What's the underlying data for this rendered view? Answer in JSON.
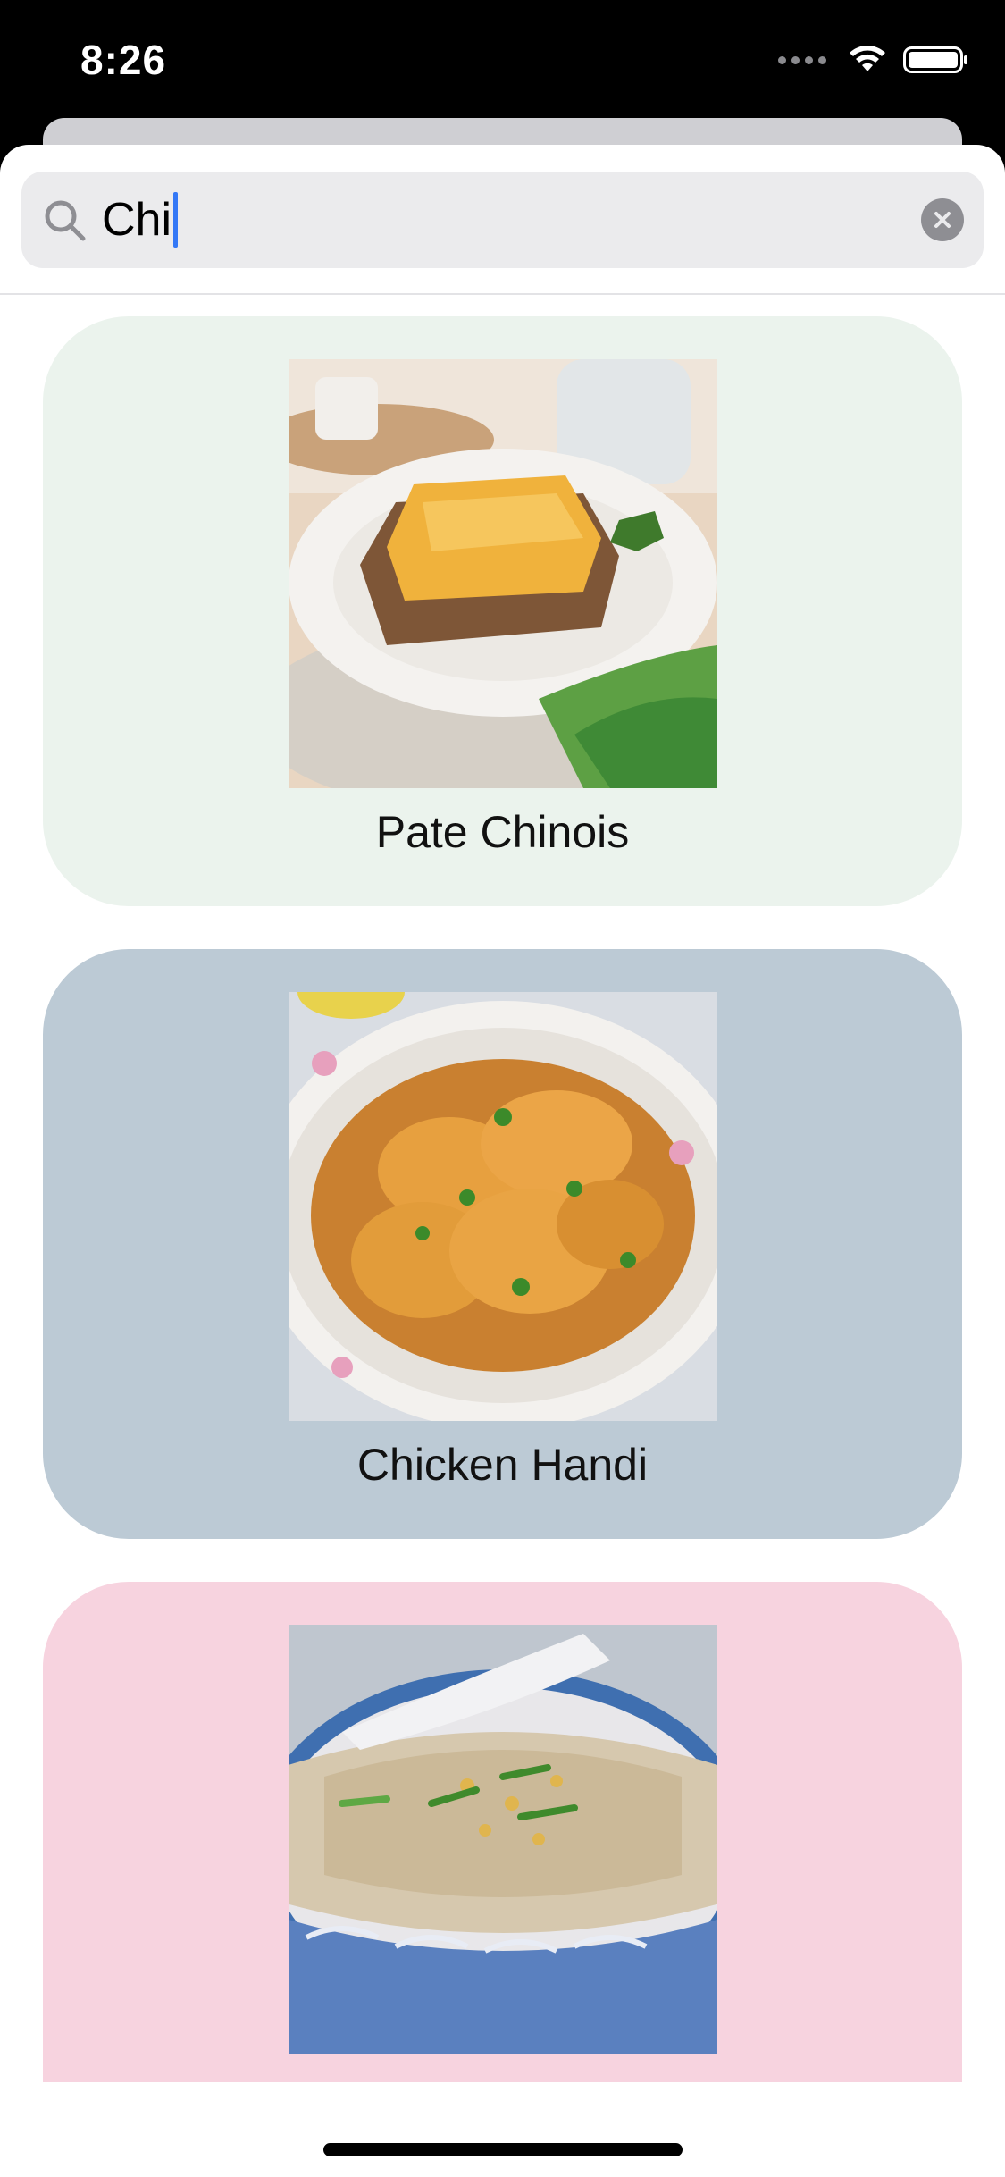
{
  "status_bar": {
    "time": "8:26"
  },
  "search": {
    "query": "Chi",
    "icon": "search-icon",
    "clear_icon": "clear-icon"
  },
  "recipes": [
    {
      "name": "Pate Chinois",
      "card_color": "#ebf3ed",
      "photo": "pate-chinois-photo"
    },
    {
      "name": "Chicken Handi",
      "card_color": "#bccad5",
      "photo": "chicken-handi-photo"
    },
    {
      "name": "",
      "card_color": "#f7d3df",
      "photo": "rice-porridge-photo"
    }
  ],
  "colors": {
    "accent_caret": "#3478f6",
    "search_field": "#ebebed"
  }
}
